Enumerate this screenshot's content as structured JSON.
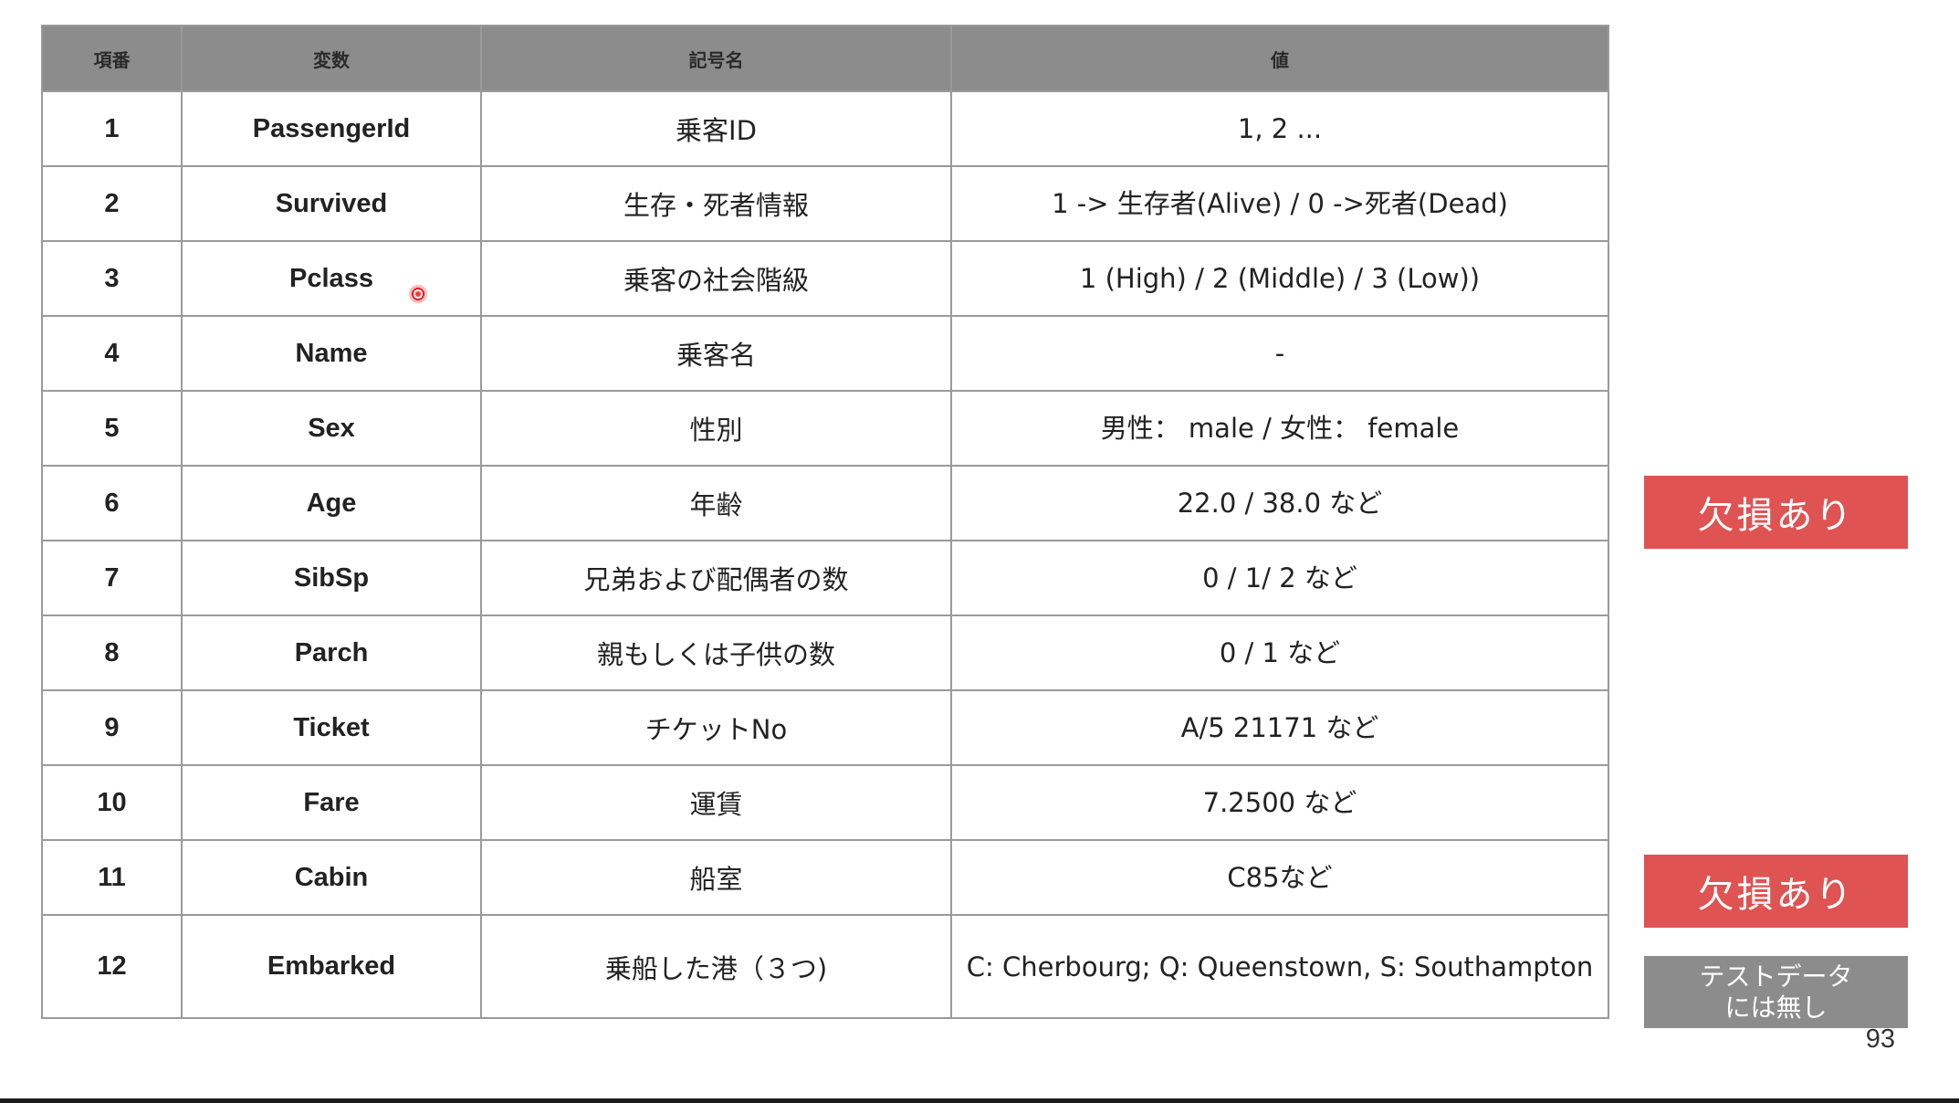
{
  "table": {
    "headers": [
      "項番",
      "変数",
      "記号名",
      "値"
    ],
    "rows": [
      {
        "no": "1",
        "variable": "PassengerId",
        "name": "乗客ID",
        "value": "1, 2 ..."
      },
      {
        "no": "2",
        "variable": "Survived",
        "name": "生存・死者情報",
        "value": "1 -> 生存者(Alive) /  0 ->死者(Dead)"
      },
      {
        "no": "3",
        "variable": "Pclass",
        "name": "乗客の社会階級",
        "value": "1 (High) / 2 (Middle) / 3 (Low))"
      },
      {
        "no": "4",
        "variable": "Name",
        "name": "乗客名",
        "value": "-"
      },
      {
        "no": "5",
        "variable": "Sex",
        "name": "性別",
        "value": "男性： male / 女性： female"
      },
      {
        "no": "6",
        "variable": "Age",
        "name": "年齢",
        "value": "22.0 / 38.0 など"
      },
      {
        "no": "7",
        "variable": "SibSp",
        "name": "兄弟および配偶者の数",
        "value": "0 / 1/ 2 など"
      },
      {
        "no": "8",
        "variable": "Parch",
        "name": "親もしくは子供の数",
        "value": "0 / 1 など"
      },
      {
        "no": "9",
        "variable": "Ticket",
        "name": "チケットNo",
        "value": "A/5 21171 など"
      },
      {
        "no": "10",
        "variable": "Fare",
        "name": "運賃",
        "value": "7.2500 など"
      },
      {
        "no": "11",
        "variable": "Cabin",
        "name": "船室",
        "value": "C85など"
      },
      {
        "no": "12",
        "variable": "Embarked",
        "name": "乗船した港（３つ)",
        "value": "C: Cherbourg; Q: Queenstown, S: Southampton"
      }
    ]
  },
  "badges": {
    "missing_age": "欠損あり",
    "missing_cabin": "欠損あり",
    "test_none_line1": "テストデータ",
    "test_none_line2": "には無し"
  },
  "page_number": "93",
  "colors": {
    "header_bg": "#8c8c8c",
    "border": "#9a9a9a",
    "badge_missing": "#df5353",
    "badge_test": "#8c8c8c"
  }
}
